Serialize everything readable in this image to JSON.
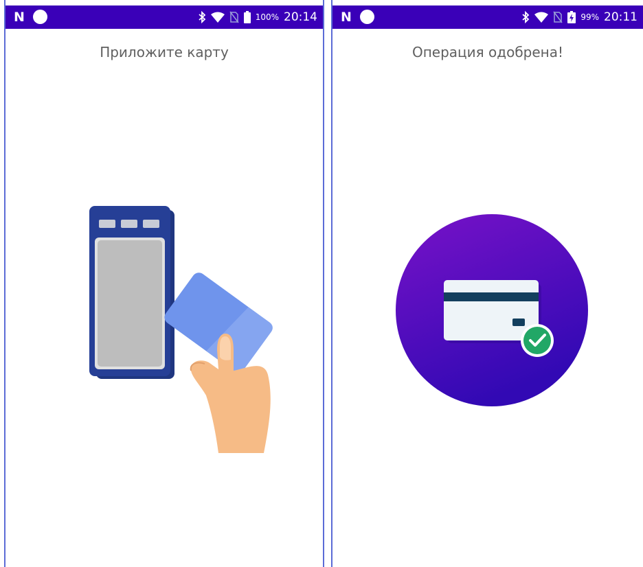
{
  "screens": [
    {
      "status": {
        "logo": "N",
        "battery_percent": "100%",
        "time": "20:14"
      },
      "title": "Приложите карту",
      "illustration": "tap-card-on-terminal"
    },
    {
      "status": {
        "logo": "N",
        "battery_percent": "99%",
        "time": "20:11"
      },
      "title": "Операция одобрена!",
      "illustration": "card-approved"
    }
  ],
  "colors": {
    "status_bar": "#3a00b8",
    "title_text": "#5f5f5f",
    "terminal_body": "#263f96",
    "terminal_screen": "#bdbdbd",
    "card": "#6f94ec",
    "hand": "#f6bb86",
    "circle_top": "#7812c8",
    "circle_bottom": "#3209b4",
    "check": "#21a766"
  },
  "icons": [
    "n-logo-icon",
    "circle-notification-icon",
    "bluetooth-icon",
    "wifi-icon",
    "no-sim-icon",
    "battery-icon",
    "check-icon"
  ]
}
